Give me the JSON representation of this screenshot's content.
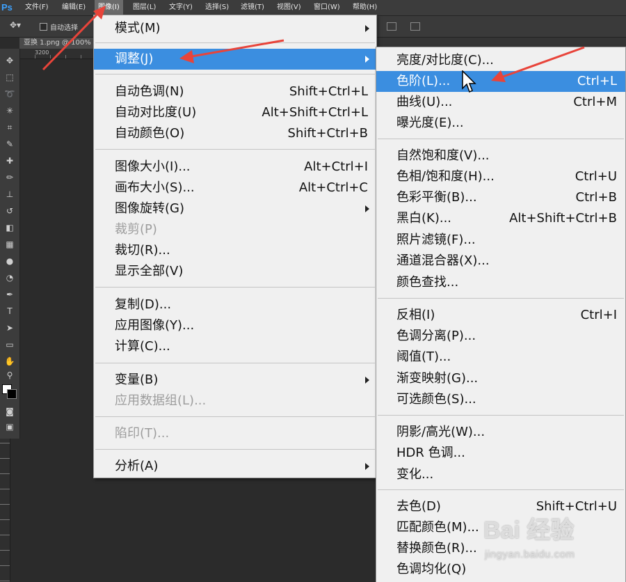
{
  "app": {
    "logo": "Ps"
  },
  "menubar": {
    "items": [
      "文件(F)",
      "编辑(E)",
      "图像(I)",
      "图层(L)",
      "文字(Y)",
      "选择(S)",
      "滤镜(T)",
      "视图(V)",
      "窗口(W)",
      "帮助(H)"
    ],
    "active_index": 2
  },
  "options_bar": {
    "auto_select_label": "自动选择"
  },
  "document": {
    "tab_title": "亚换 1.png @ 100%",
    "ruler_top_label": "3200"
  },
  "image_menu": {
    "mode": {
      "label": "模式(M)"
    },
    "adjustments": {
      "label": "调整(J)"
    },
    "auto_tone": {
      "label": "自动色调(N)",
      "shortcut": "Shift+Ctrl+L"
    },
    "auto_contrast": {
      "label": "自动对比度(U)",
      "shortcut": "Alt+Shift+Ctrl+L"
    },
    "auto_color": {
      "label": "自动颜色(O)",
      "shortcut": "Shift+Ctrl+B"
    },
    "image_size": {
      "label": "图像大小(I)...",
      "shortcut": "Alt+Ctrl+I"
    },
    "canvas_size": {
      "label": "画布大小(S)...",
      "shortcut": "Alt+Ctrl+C"
    },
    "image_rotation": {
      "label": "图像旋转(G)"
    },
    "crop": {
      "label": "裁剪(P)"
    },
    "trim": {
      "label": "裁切(R)..."
    },
    "reveal_all": {
      "label": "显示全部(V)"
    },
    "duplicate": {
      "label": "复制(D)..."
    },
    "apply_image": {
      "label": "应用图像(Y)..."
    },
    "calculations": {
      "label": "计算(C)..."
    },
    "variables": {
      "label": "变量(B)"
    },
    "apply_data_set": {
      "label": "应用数据组(L)..."
    },
    "trap": {
      "label": "陷印(T)..."
    },
    "analysis": {
      "label": "分析(A)"
    }
  },
  "adjust_menu": {
    "brightness_contrast": {
      "label": "亮度/对比度(C)..."
    },
    "levels": {
      "label": "色阶(L)...",
      "shortcut": "Ctrl+L"
    },
    "curves": {
      "label": "曲线(U)...",
      "shortcut": "Ctrl+M"
    },
    "exposure": {
      "label": "曝光度(E)..."
    },
    "vibrance": {
      "label": "自然饱和度(V)..."
    },
    "hue_saturation": {
      "label": "色相/饱和度(H)...",
      "shortcut": "Ctrl+U"
    },
    "color_balance": {
      "label": "色彩平衡(B)...",
      "shortcut": "Ctrl+B"
    },
    "black_white": {
      "label": "黑白(K)...",
      "shortcut": "Alt+Shift+Ctrl+B"
    },
    "photo_filter": {
      "label": "照片滤镜(F)..."
    },
    "channel_mixer": {
      "label": "通道混合器(X)..."
    },
    "color_lookup": {
      "label": "颜色查找..."
    },
    "invert": {
      "label": "反相(I)",
      "shortcut": "Ctrl+I"
    },
    "posterize": {
      "label": "色调分离(P)..."
    },
    "threshold": {
      "label": "阈值(T)..."
    },
    "gradient_map": {
      "label": "渐变映射(G)..."
    },
    "selective_color": {
      "label": "可选颜色(S)..."
    },
    "shadows_highlights": {
      "label": "阴影/高光(W)..."
    },
    "hdr_toning": {
      "label": "HDR 色调..."
    },
    "variations": {
      "label": "变化..."
    },
    "desaturate": {
      "label": "去色(D)",
      "shortcut": "Shift+Ctrl+U"
    },
    "match_color": {
      "label": "匹配颜色(M)..."
    },
    "replace_color": {
      "label": "替换颜色(R)..."
    },
    "equalize": {
      "label": "色调均化(Q)"
    }
  },
  "watermark": {
    "main": "Bai 经验",
    "sub": "jingyan.baidu.com"
  },
  "colors": {
    "highlight": "#3b8ee0",
    "menu_bg": "#f0f0f0",
    "annotation_arrow": "#e8443a",
    "chrome": "#2b2b2b"
  }
}
